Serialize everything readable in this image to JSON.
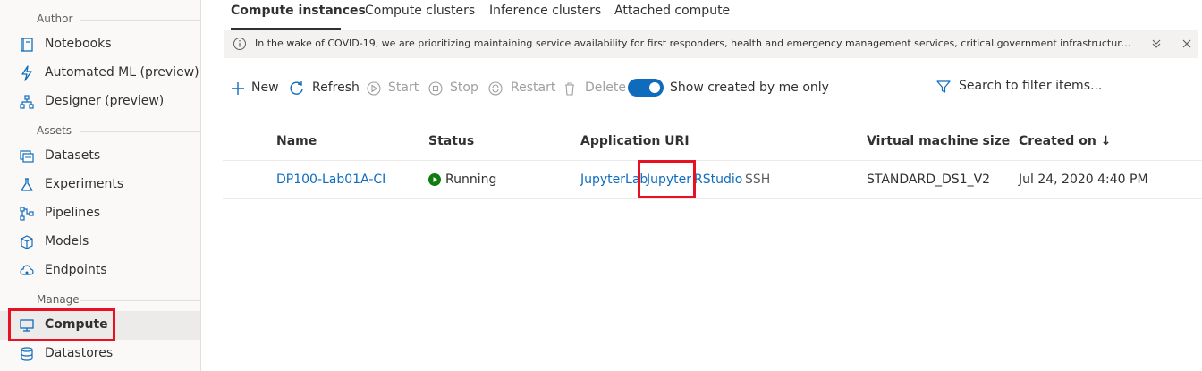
{
  "sidebar": {
    "sections": [
      {
        "label": "Author"
      },
      {
        "label": "Assets"
      },
      {
        "label": "Manage"
      }
    ],
    "items": [
      {
        "label": "Notebooks",
        "icon": "notebook-icon"
      },
      {
        "label": "Automated ML (preview)",
        "icon": "lightning-icon"
      },
      {
        "label": "Designer (preview)",
        "icon": "designer-icon"
      },
      {
        "label": "Datasets",
        "icon": "dataset-icon"
      },
      {
        "label": "Experiments",
        "icon": "flask-icon"
      },
      {
        "label": "Pipelines",
        "icon": "pipeline-icon"
      },
      {
        "label": "Models",
        "icon": "cube-icon"
      },
      {
        "label": "Endpoints",
        "icon": "cloud-icon"
      },
      {
        "label": "Compute",
        "icon": "monitor-icon",
        "selected": true
      },
      {
        "label": "Datastores",
        "icon": "database-icon"
      }
    ]
  },
  "tabs": [
    {
      "label": "Compute instances",
      "active": true
    },
    {
      "label": "Compute clusters"
    },
    {
      "label": "Inference clusters"
    },
    {
      "label": "Attached compute"
    }
  ],
  "banner": {
    "text": "In the wake of COVID-19, we are prioritizing maintaining service availability for first responders, health and emergency management services, critical government infrastructure, and exis..."
  },
  "toolbar": {
    "new": "New",
    "refresh": "Refresh",
    "start": "Start",
    "stop": "Stop",
    "restart": "Restart",
    "delete": "Delete",
    "toggle_label": "Show created by me only",
    "toggle_on": true,
    "search_placeholder": "Search to filter items..."
  },
  "table": {
    "columns": [
      "Name",
      "Status",
      "Application URI",
      "Virtual machine size",
      "Created on ↓"
    ],
    "rows": [
      {
        "name": "DP100-Lab01A-CI",
        "status": "Running",
        "uris": [
          "JupyterLab",
          "Jupyter",
          "RStudio",
          "SSH"
        ],
        "vm_size": "STANDARD_DS1_V2",
        "created": "Jul 24, 2020 4:40 PM"
      }
    ]
  },
  "colors": {
    "accent": "#0f6cbd",
    "highlight": "#e81123",
    "running": "#107c10"
  }
}
